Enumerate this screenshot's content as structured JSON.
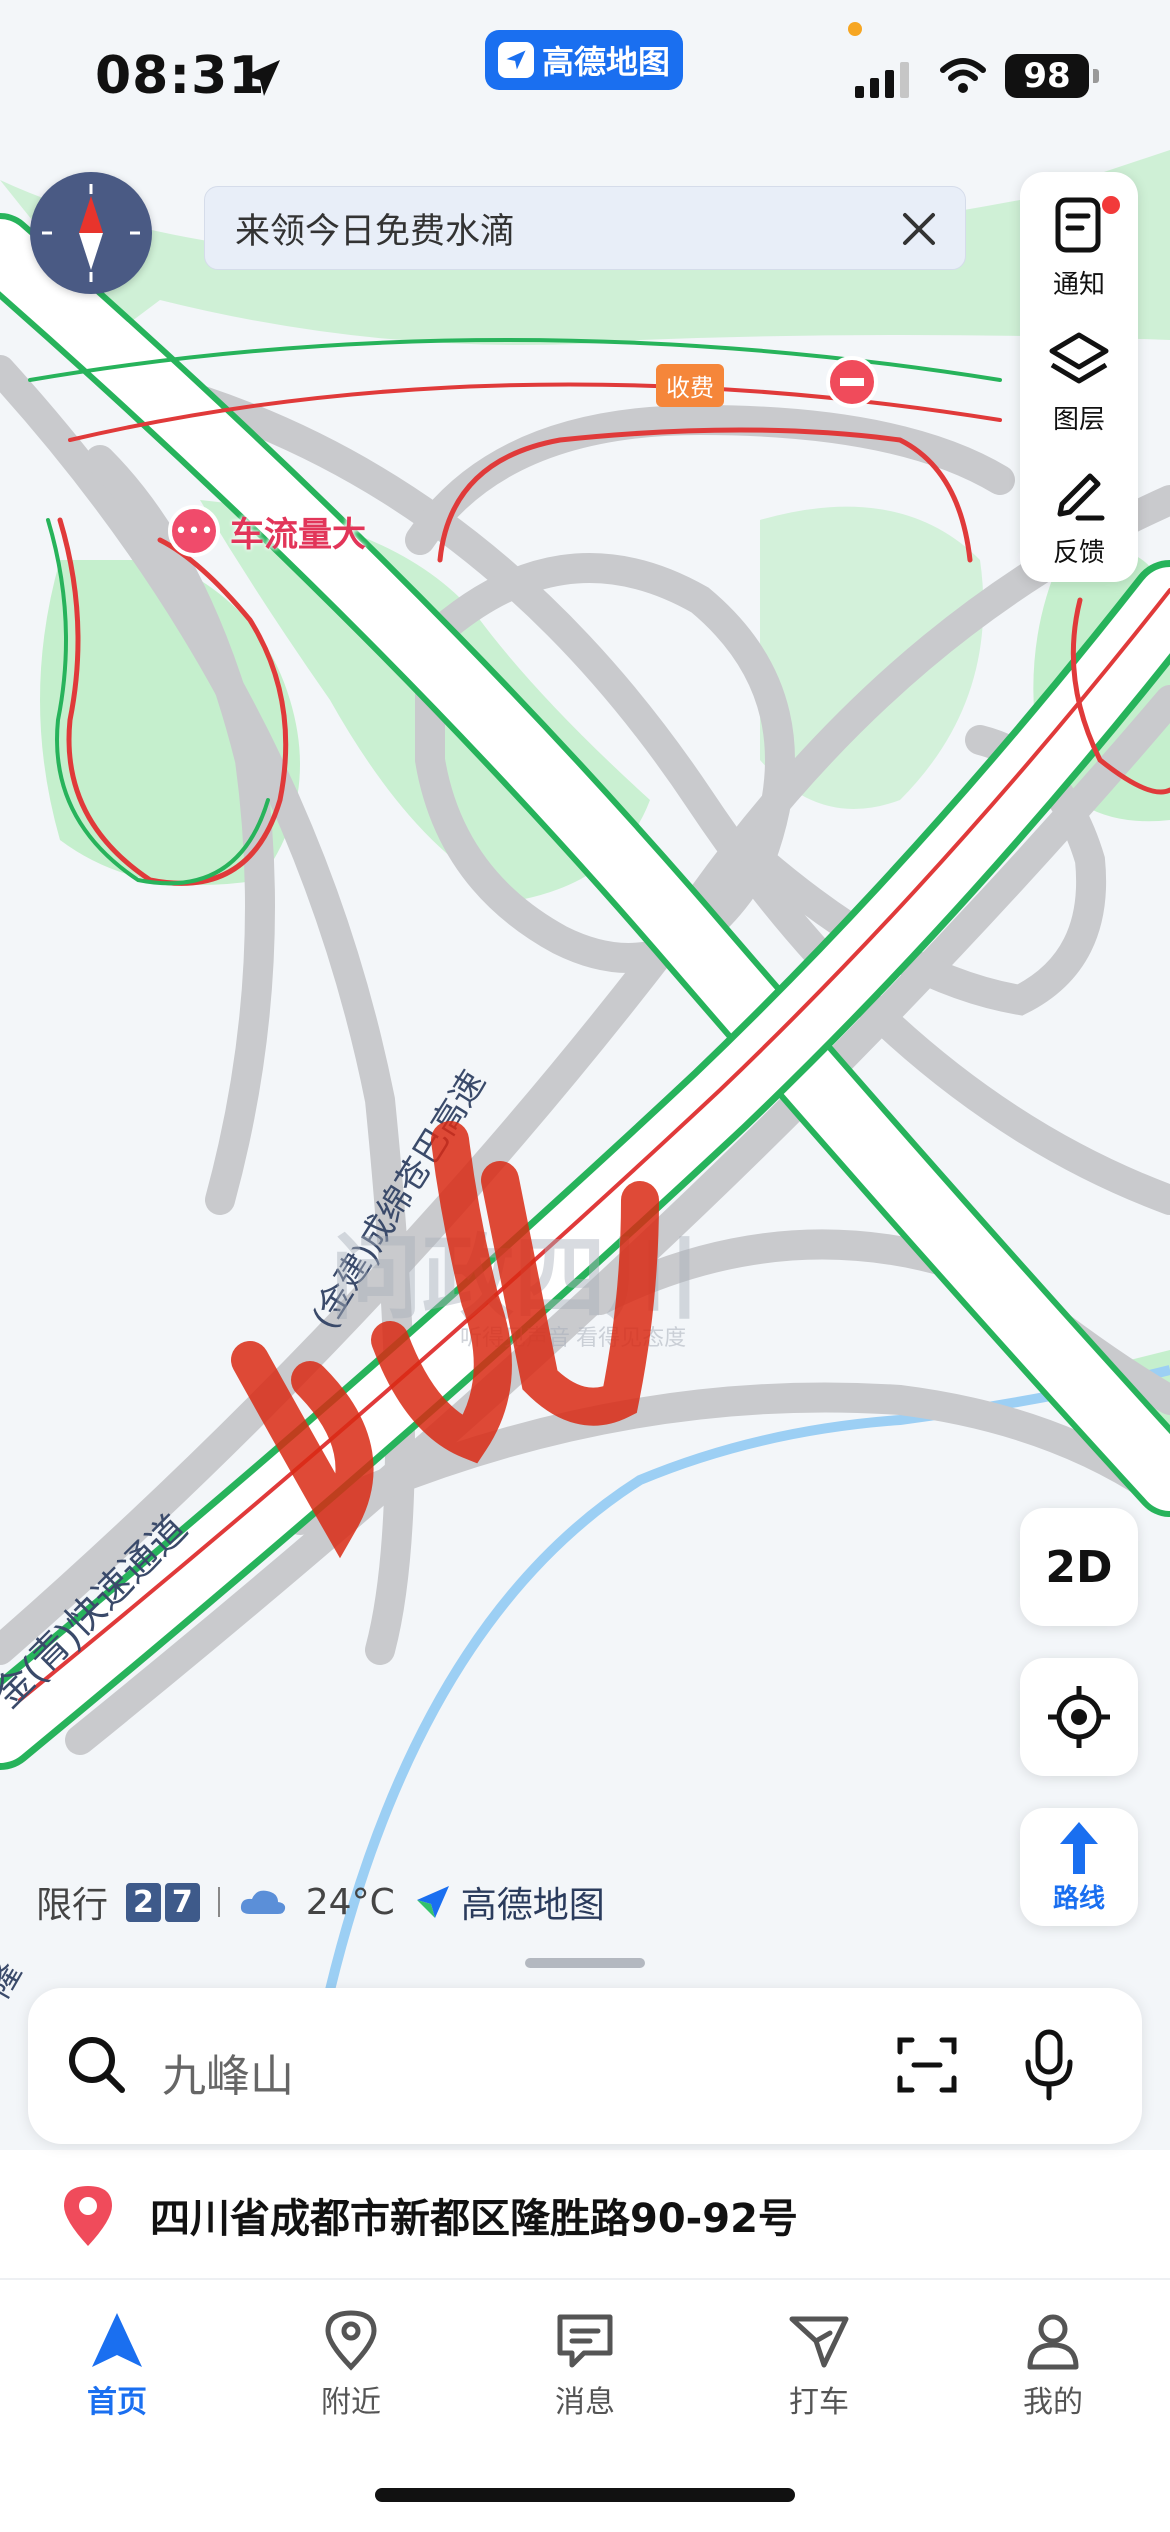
{
  "status_bar": {
    "time": "08:31",
    "app_badge": "高德地图",
    "battery": "98"
  },
  "banner": {
    "text": "来领今日免费水滴"
  },
  "tools": [
    {
      "label": "通知",
      "icon": "notice-icon"
    },
    {
      "label": "图层",
      "icon": "layers-icon"
    },
    {
      "label": "反馈",
      "icon": "feedback-icon"
    }
  ],
  "map": {
    "traffic_label": "车流量大",
    "toll_label": "收费",
    "road_labels": [
      "(金建)成绵苍巴高速",
      "金(青)快速通道"
    ],
    "watermark": "问政四川",
    "watermark_sub": "听得见声音 看得见态度",
    "edge_label": "隆"
  },
  "controls": {
    "view_mode": "2D",
    "route_label": "路线"
  },
  "info": {
    "restriction_label": "限行",
    "restriction_digits": [
      "2",
      "7"
    ],
    "temperature": "24°C",
    "brand": "高德地图"
  },
  "search": {
    "placeholder": "九峰山"
  },
  "address": "四川省成都市新都区隆胜路90-92号",
  "tabs": [
    {
      "label": "首页",
      "icon": "navigation-arrow-icon",
      "active": true
    },
    {
      "label": "附近",
      "icon": "location-pin-icon",
      "active": false
    },
    {
      "label": "消息",
      "icon": "message-icon",
      "active": false
    },
    {
      "label": "打车",
      "icon": "taxi-icon",
      "active": false
    },
    {
      "label": "我的",
      "icon": "user-icon",
      "active": false
    }
  ],
  "colors": {
    "accent": "#1a6ff0",
    "traffic_green": "#27b35b",
    "traffic_red": "#e03a3a",
    "green_area": "#b8ecc2"
  }
}
